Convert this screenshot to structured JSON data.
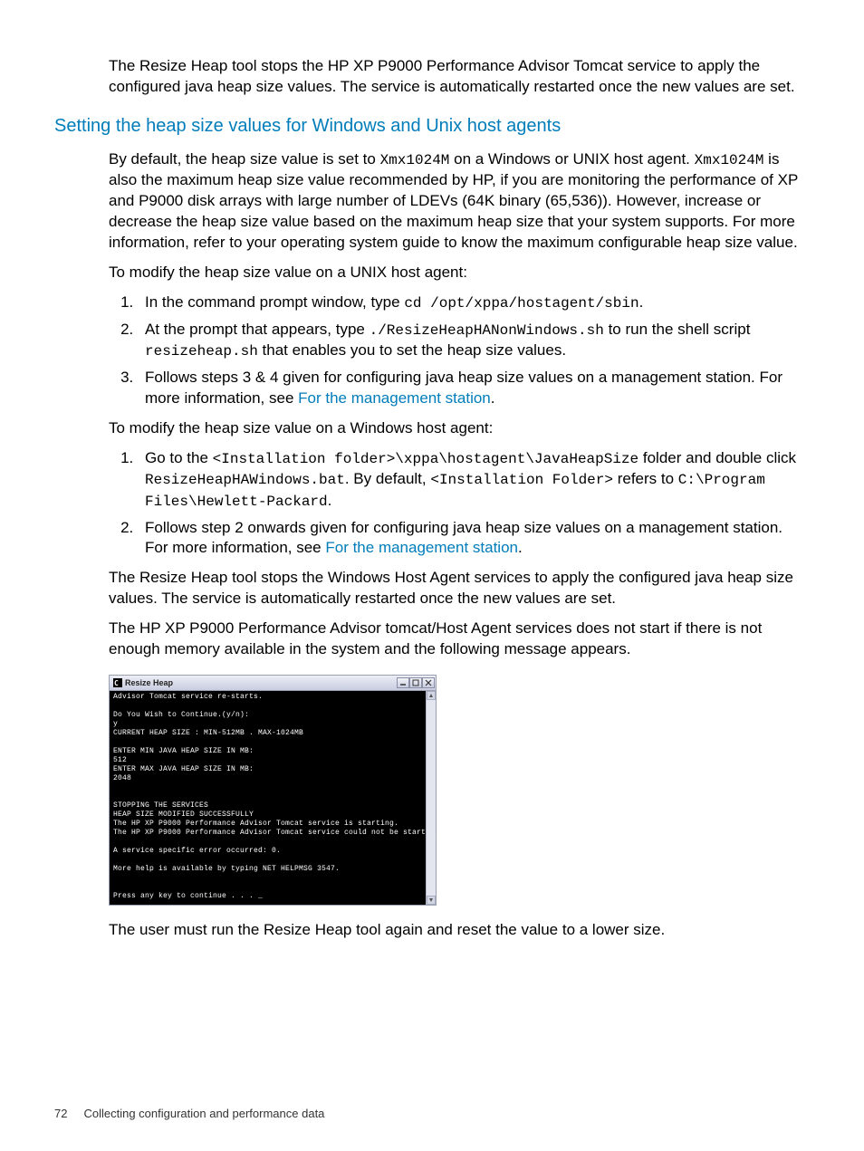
{
  "intro_paragraph": "The Resize Heap tool stops the HP XP P9000 Performance Advisor Tomcat service to apply the configured java heap size values. The service is automatically restarted once the new values are set.",
  "section_heading": "Setting the heap size values for Windows and Unix host agents",
  "p1": {
    "t1": "By default, the heap size value is set to ",
    "c1": "Xmx1024M",
    "t2": " on a Windows or UNIX host agent. ",
    "c2": "Xmx1024M",
    "t3": " is also the maximum heap size value recommended by HP, if you are monitoring the performance of XP and P9000 disk arrays with large number of LDEVs (64K binary (65,536)). However, increase or decrease the heap size value based on the maximum heap size that your system supports. For more information, refer to your operating system guide to know the maximum configurable heap size value."
  },
  "unix_intro": "To modify the heap size value on a UNIX host agent:",
  "unix_steps": {
    "s1": {
      "t1": "In the command prompt window, type ",
      "c1": "cd /opt/xppa/hostagent/sbin",
      "t2": "."
    },
    "s2": {
      "t1": "At the prompt that appears, type ",
      "c1": "./ResizeHeapHANonWindows.sh",
      "t2": " to run the shell script ",
      "c2": "resizeheap.sh",
      "t3": " that enables you to set the heap size values."
    },
    "s3": {
      "t1": "Follows steps 3 & 4 given for configuring java heap size values on a management station. For more information, see ",
      "link": "For the management station",
      "t2": "."
    }
  },
  "win_intro": "To modify the heap size value on a Windows host agent:",
  "win_steps": {
    "s1": {
      "t1": "Go to the ",
      "c1": "<Installation folder>\\xppa\\hostagent\\JavaHeapSize",
      "t2": " folder and double click ",
      "c2": "ResizeHeapHAWindows.bat",
      "t3": ". By default, ",
      "c3": "<Installation Folder>",
      "t4": " refers to ",
      "c4": "C:\\Program Files\\Hewlett-Packard",
      "t5": "."
    },
    "s2": {
      "t1": "Follows step 2 onwards given for configuring java heap size values on a management station. For more information, see ",
      "link": "For the management station",
      "t2": "."
    }
  },
  "post1": "The Resize Heap tool stops the Windows Host Agent services to apply the configured java heap size values. The service is automatically restarted once the new values are set.",
  "post2": "The HP XP P9000 Performance Advisor tomcat/Host Agent services does not start if there is not enough memory available in the system and the following message appears.",
  "terminal": {
    "title": "Resize Heap",
    "lines": "Advisor Tomcat service re-starts.\n\nDo You Wish to Continue.(y/n):\ny\nCURRENT HEAP SIZE : MIN-512MB . MAX-1024MB\n\nENTER MIN JAVA HEAP SIZE IN MB:\n512\nENTER MAX JAVA HEAP SIZE IN MB:\n2048\n\n\nSTOPPING THE SERVICES\nHEAP SIZE MODIFIED SUCCESSFULLY\nThe HP XP P9000 Performance Advisor Tomcat service is starting.\nThe HP XP P9000 Performance Advisor Tomcat service could not be started.\n\nA service specific error occurred: 0.\n\nMore help is available by typing NET HELPMSG 3547.\n\n\nPress any key to continue . . . _"
  },
  "closing": "The user must run the Resize Heap tool again and reset the value to a lower size.",
  "footer": {
    "page": "72",
    "title": "Collecting configuration and performance data"
  }
}
